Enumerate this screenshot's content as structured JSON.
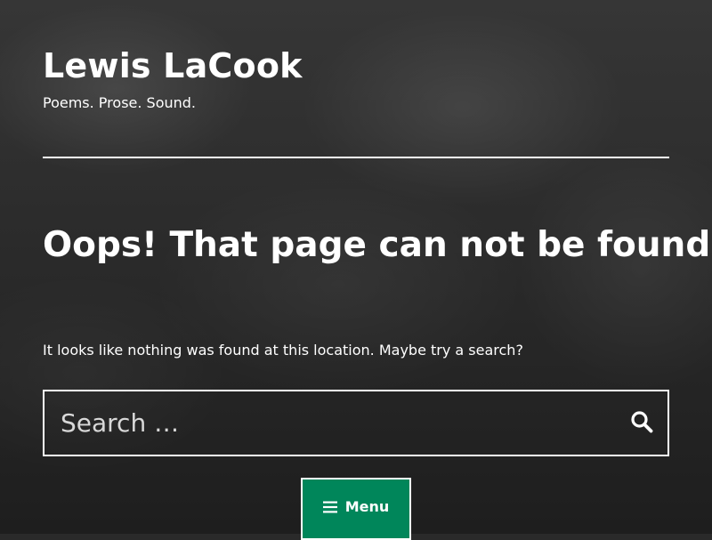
{
  "site": {
    "title": "Lewis LaCook",
    "tagline": "Poems. Prose. Sound."
  },
  "main": {
    "page_title": "Oops! That page can not be found.",
    "message": "It looks like nothing was found at this location. Maybe try a search?"
  },
  "search": {
    "placeholder": "Search …",
    "value": "",
    "button_icon": "search-icon"
  },
  "nav": {
    "menu_label": "Menu",
    "menu_icon": "hamburger-icon",
    "accent_color": "#00865a"
  }
}
